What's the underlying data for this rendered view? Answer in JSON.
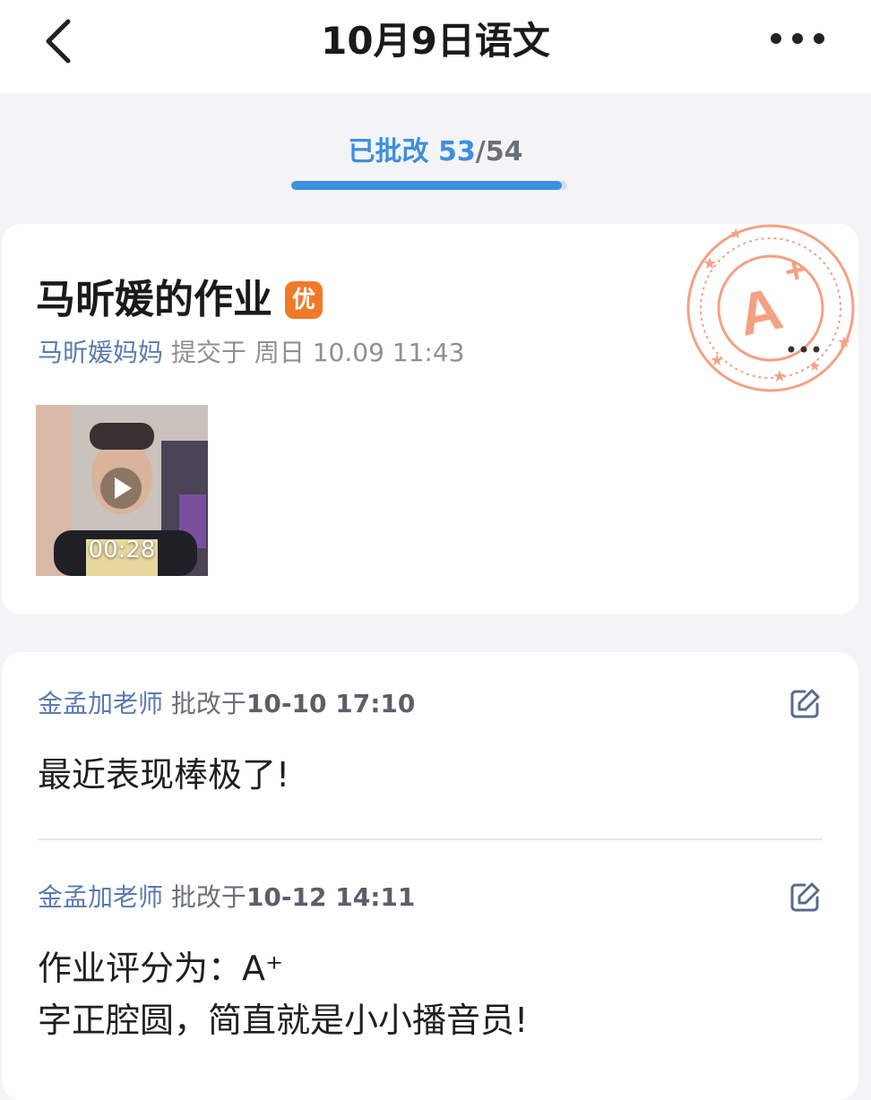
{
  "header": {
    "title": "10月9日语文",
    "back_icon": "chevron-left-icon",
    "more_icon": "more-dots-icon"
  },
  "progress": {
    "label": "已批改",
    "done": "53",
    "separator": "/",
    "total": "54",
    "fraction": 0.9815,
    "color": "#3d8fe0"
  },
  "submission": {
    "title": "马昕媛的作业",
    "badge": "优",
    "badge_color": "#f07a2a",
    "submitter": "马昕媛妈妈",
    "submit_verb": "提交于",
    "submit_time": "周日 10.09 11:43",
    "video_duration": "00:28",
    "stamp_grade": "A+",
    "stamp_color": "#f4a183"
  },
  "reviews": [
    {
      "teacher": "金孟加老师",
      "verb": "批改于",
      "time": "10-10 17:10",
      "text": "最近表现棒极了!"
    },
    {
      "teacher": "金孟加老师",
      "verb": "批改于",
      "time": "10-12 14:11",
      "text_line1": "作业评分为：A⁺",
      "text_line2": "字正腔圆，简直就是小小播音员!"
    }
  ]
}
